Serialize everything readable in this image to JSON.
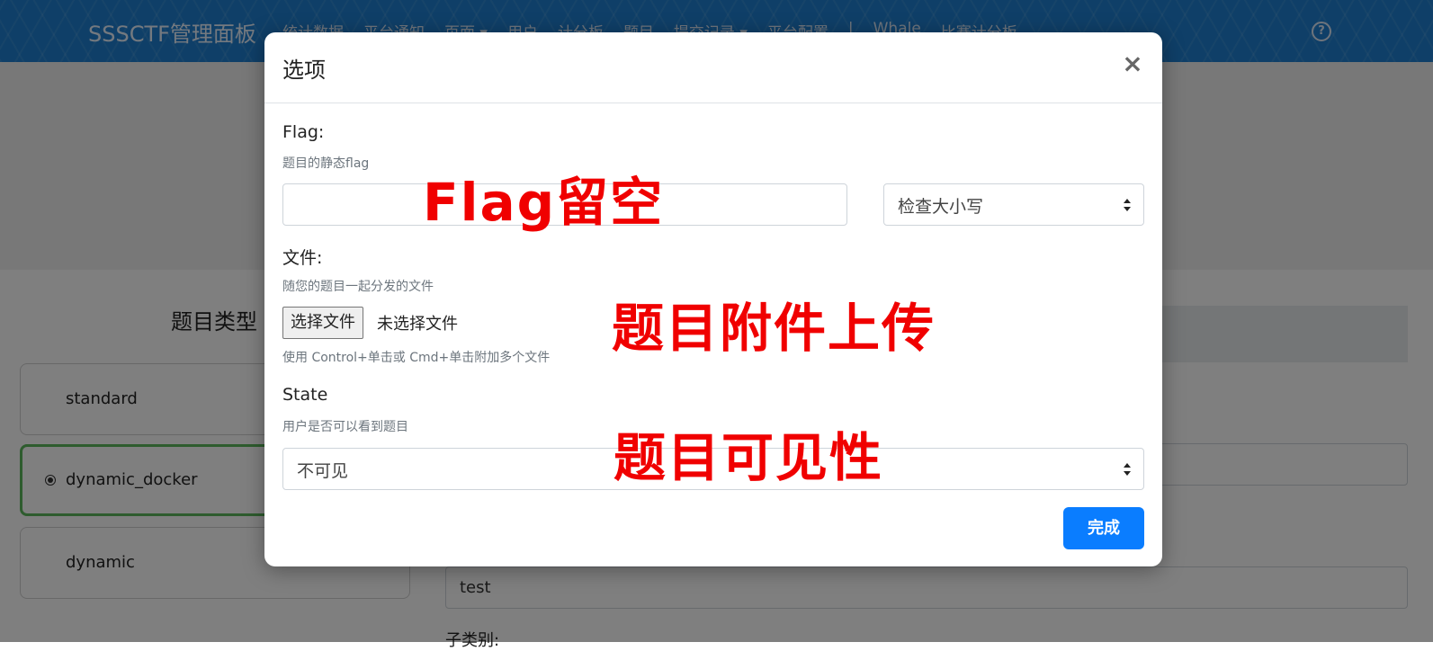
{
  "navbar": {
    "brand": "SSSCTF管理面板",
    "items": [
      "统计数据",
      "平台通知",
      "页面 ▾",
      "用户",
      "计分板",
      "题目",
      "提交记录 ▾",
      "平台配置",
      "|",
      "Whale",
      "比赛计分板"
    ]
  },
  "page": {
    "type_heading": "题目类型",
    "types": [
      {
        "label": "standard",
        "selected": false
      },
      {
        "label": "dynamic_docker",
        "selected": true
      },
      {
        "label": "dynamic",
        "selected": false
      }
    ],
    "name_value": "test",
    "subcategory_label": "子类别:"
  },
  "modal": {
    "title": "选项",
    "close_glyph": "×",
    "flag": {
      "label": "Flag:",
      "help": "题目的静态flag",
      "value": "",
      "case_select": "检查大小写"
    },
    "file": {
      "label": "文件:",
      "help": "随您的题目一起分发的文件",
      "button": "选择文件",
      "status": "未选择文件",
      "hint": "使用 Control+单击或 Cmd+单击附加多个文件"
    },
    "state": {
      "label": "State",
      "help": "用户是否可以看到题目",
      "value": "不可见"
    },
    "done_button": "完成"
  },
  "annotations": {
    "flag_note": "Flag留空",
    "file_note": "题目附件上传",
    "state_note": "题目可见性"
  },
  "colors": {
    "navbar": "#1f7fd0",
    "primary": "#0a7dff",
    "selected_border": "#5cb85c",
    "annotation": "#f00000"
  }
}
